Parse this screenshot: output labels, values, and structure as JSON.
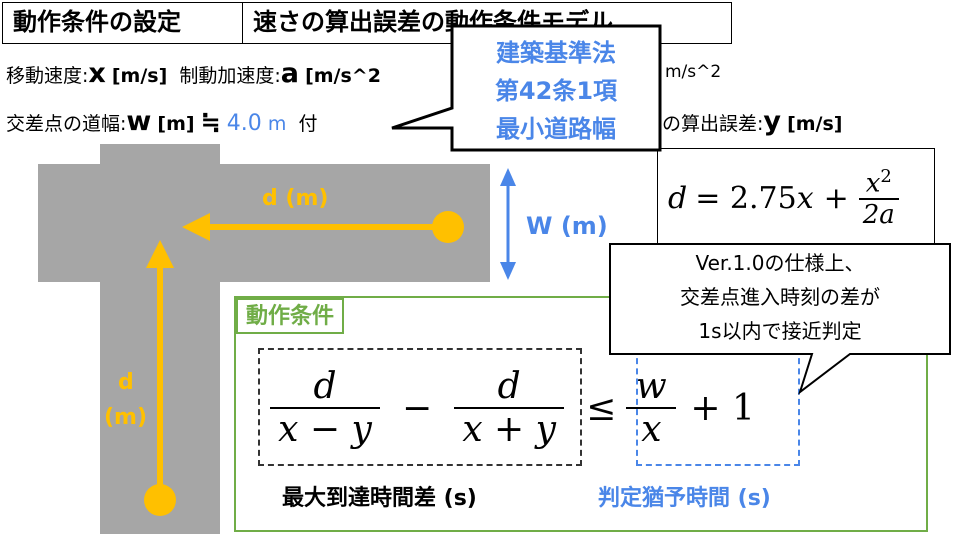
{
  "title": {
    "left": "動作条件の設定",
    "right": "速さの算出誤差の動作条件モデル"
  },
  "params": {
    "speed_label": "移動速度:",
    "speed_var": "x",
    "speed_unit": "[m/s]",
    "decel_label": "制動加速度:",
    "decel_var": "a",
    "decel_unit": "[m/s^2",
    "decel_unit_tail": "m/s^2",
    "width_label": "交差点の道幅:",
    "width_var": "w",
    "width_unit": "[m]",
    "approx_symbol": "≒",
    "width_value": "4.0",
    "width_value_unit": "m",
    "hidden_fragment": "付",
    "error_label": "の算出誤差:",
    "error_var": "y",
    "error_unit": "[m/s]"
  },
  "law_callout": {
    "line1": "建築基準法",
    "line2": "第42条1項",
    "line3": "最小道路幅"
  },
  "diagram": {
    "d_label_top": "d (m)",
    "d_label_left_1": "d",
    "d_label_left_2": "(m)",
    "w_label": "W (m)"
  },
  "formula_d": {
    "lhs": "d",
    "eq": "= 2.75",
    "x": "x",
    "plus": "+",
    "num": "x",
    "num_exp": "2",
    "den": "2a"
  },
  "spec_callout": {
    "line1": "Ver.1.0の仕様上、",
    "line2": "交差点進入時刻の差が",
    "line3": "1s以内で接近判定"
  },
  "condition": {
    "label": "動作条件",
    "frac1_num": "d",
    "frac1_den": "x − y",
    "minus": "−",
    "frac2_num": "d",
    "frac2_den": "x + y",
    "leq": "≤",
    "frac3_num": "w",
    "frac3_den": "x",
    "plus_one": "+ 1",
    "caption_left": "最大到達時間差 (s)",
    "caption_right": "判定猶予時間 (s)"
  },
  "colors": {
    "road": "#a6a6a6",
    "arrow": "#ffc000",
    "accent_blue": "#4a86e8",
    "condition_border": "#70ad47"
  }
}
